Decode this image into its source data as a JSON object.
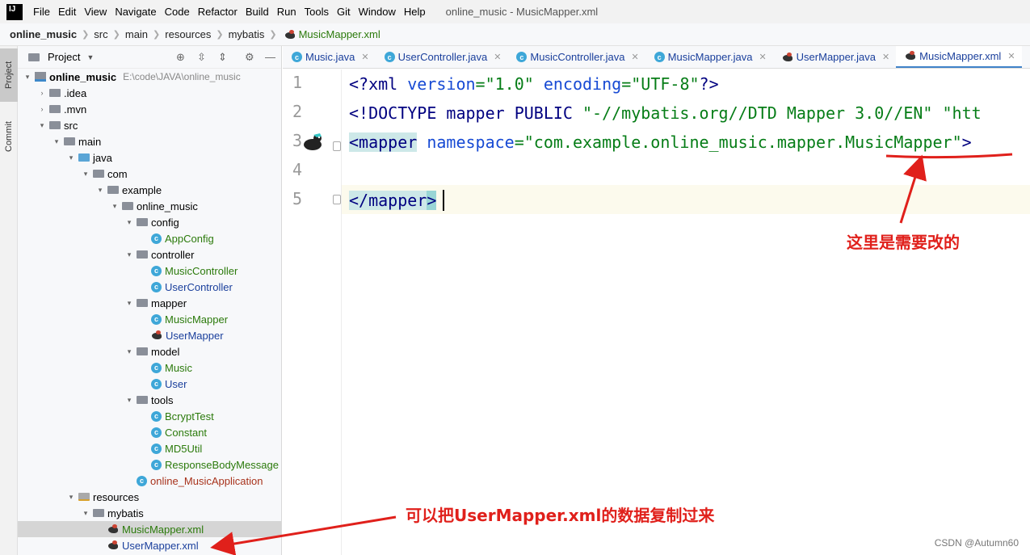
{
  "menubar": {
    "logo": "IJ",
    "items": [
      "File",
      "Edit",
      "View",
      "Navigate",
      "Code",
      "Refactor",
      "Build",
      "Run",
      "Tools",
      "Git",
      "Window",
      "Help"
    ],
    "window_title": "online_music - MusicMapper.xml"
  },
  "breadcrumb": {
    "items": [
      "online_music",
      "src",
      "main",
      "resources",
      "mybatis",
      "MusicMapper.xml"
    ]
  },
  "tool_stripe": {
    "project": "Project",
    "commit": "Commit"
  },
  "project_panel": {
    "title": "Project",
    "root_path": "E:\\code\\JAVA\\online_music",
    "tree": [
      {
        "label": "online_music",
        "indent": 0,
        "arrow": "▾",
        "icon": "project",
        "style": "bold"
      },
      {
        "label": ".idea",
        "indent": 1,
        "arrow": "›",
        "icon": "folder",
        "style": "black"
      },
      {
        "label": ".mvn",
        "indent": 1,
        "arrow": "›",
        "icon": "folder",
        "style": "black"
      },
      {
        "label": "src",
        "indent": 1,
        "arrow": "▾",
        "icon": "folder",
        "style": "black"
      },
      {
        "label": "main",
        "indent": 2,
        "arrow": "▾",
        "icon": "folder",
        "style": "black"
      },
      {
        "label": "java",
        "indent": 3,
        "arrow": "▾",
        "icon": "folder-blue",
        "style": "black"
      },
      {
        "label": "com",
        "indent": 4,
        "arrow": "▾",
        "icon": "folder",
        "style": "black"
      },
      {
        "label": "example",
        "indent": 5,
        "arrow": "▾",
        "icon": "folder",
        "style": "black"
      },
      {
        "label": "online_music",
        "indent": 6,
        "arrow": "▾",
        "icon": "folder",
        "style": "black"
      },
      {
        "label": "config",
        "indent": 7,
        "arrow": "▾",
        "icon": "folder",
        "style": "black"
      },
      {
        "label": "AppConfig",
        "indent": 8,
        "arrow": "",
        "icon": "class",
        "style": "green"
      },
      {
        "label": "controller",
        "indent": 7,
        "arrow": "▾",
        "icon": "folder",
        "style": "black"
      },
      {
        "label": "MusicController",
        "indent": 8,
        "arrow": "",
        "icon": "class",
        "style": "green"
      },
      {
        "label": "UserController",
        "indent": 8,
        "arrow": "",
        "icon": "class",
        "style": "blue"
      },
      {
        "label": "mapper",
        "indent": 7,
        "arrow": "▾",
        "icon": "folder",
        "style": "black"
      },
      {
        "label": "MusicMapper",
        "indent": 8,
        "arrow": "",
        "icon": "class",
        "style": "green"
      },
      {
        "label": "UserMapper",
        "indent": 8,
        "arrow": "",
        "icon": "bird",
        "style": "blue"
      },
      {
        "label": "model",
        "indent": 7,
        "arrow": "▾",
        "icon": "folder",
        "style": "black"
      },
      {
        "label": "Music",
        "indent": 8,
        "arrow": "",
        "icon": "class",
        "style": "green"
      },
      {
        "label": "User",
        "indent": 8,
        "arrow": "",
        "icon": "class",
        "style": "blue"
      },
      {
        "label": "tools",
        "indent": 7,
        "arrow": "▾",
        "icon": "folder",
        "style": "black"
      },
      {
        "label": "BcryptTest",
        "indent": 8,
        "arrow": "",
        "icon": "class",
        "style": "green"
      },
      {
        "label": "Constant",
        "indent": 8,
        "arrow": "",
        "icon": "class",
        "style": "green"
      },
      {
        "label": "MD5Util",
        "indent": 8,
        "arrow": "",
        "icon": "class",
        "style": "green"
      },
      {
        "label": "ResponseBodyMessage",
        "indent": 8,
        "arrow": "",
        "icon": "class",
        "style": "green"
      },
      {
        "label": "online_MusicApplication",
        "indent": 7,
        "arrow": "",
        "icon": "class",
        "style": "red"
      },
      {
        "label": "resources",
        "indent": 3,
        "arrow": "▾",
        "icon": "folder-res",
        "style": "black"
      },
      {
        "label": "mybatis",
        "indent": 4,
        "arrow": "▾",
        "icon": "folder",
        "style": "black"
      },
      {
        "label": "MusicMapper.xml",
        "indent": 5,
        "arrow": "",
        "icon": "bird",
        "style": "green",
        "selected": true
      },
      {
        "label": "UserMapper.xml",
        "indent": 5,
        "arrow": "",
        "icon": "bird",
        "style": "blue"
      }
    ]
  },
  "editor_tabs": [
    {
      "label": "Music.java",
      "icon": "class",
      "active": false
    },
    {
      "label": "UserController.java",
      "icon": "class",
      "active": false
    },
    {
      "label": "MusicController.java",
      "icon": "class",
      "active": false
    },
    {
      "label": "MusicMapper.java",
      "icon": "class",
      "active": false
    },
    {
      "label": "UserMapper.java",
      "icon": "bird",
      "active": false
    },
    {
      "label": "MusicMapper.xml",
      "icon": "bird",
      "active": true
    }
  ],
  "editor": {
    "line_numbers": [
      "1",
      "2",
      "3",
      "4",
      "5"
    ],
    "line1": {
      "open": "<?",
      "name": "xml",
      "a1": " version",
      "eq1": "=",
      "v1": "\"1.0\"",
      "a2": " encoding",
      "eq2": "=",
      "v2": "\"UTF-8\"",
      "close": "?>"
    },
    "line2": {
      "open": "<!DOCTYPE mapper PUBLIC ",
      "v1": "\"-//mybatis.org//DTD Mapper 3.0//EN\"",
      "rest": " \"htt"
    },
    "line3": {
      "lt": "<",
      "tag": "mapper",
      "attr": " namespace",
      "eq": "=",
      "v_prefix": "\"com.example.online_music.mapper.",
      "v_hl": "MusicMapper",
      "v_suffix": "\"",
      "gt": ">"
    },
    "line5": {
      "lt": "</",
      "tag": "mapper",
      "gt": ">"
    }
  },
  "annotations": {
    "change_here": "这里是需要改的",
    "copy_from": "可以把UserMapper.xml的数据复制过来",
    "color": "#e0201b"
  },
  "watermark": "CSDN @Autumn60"
}
